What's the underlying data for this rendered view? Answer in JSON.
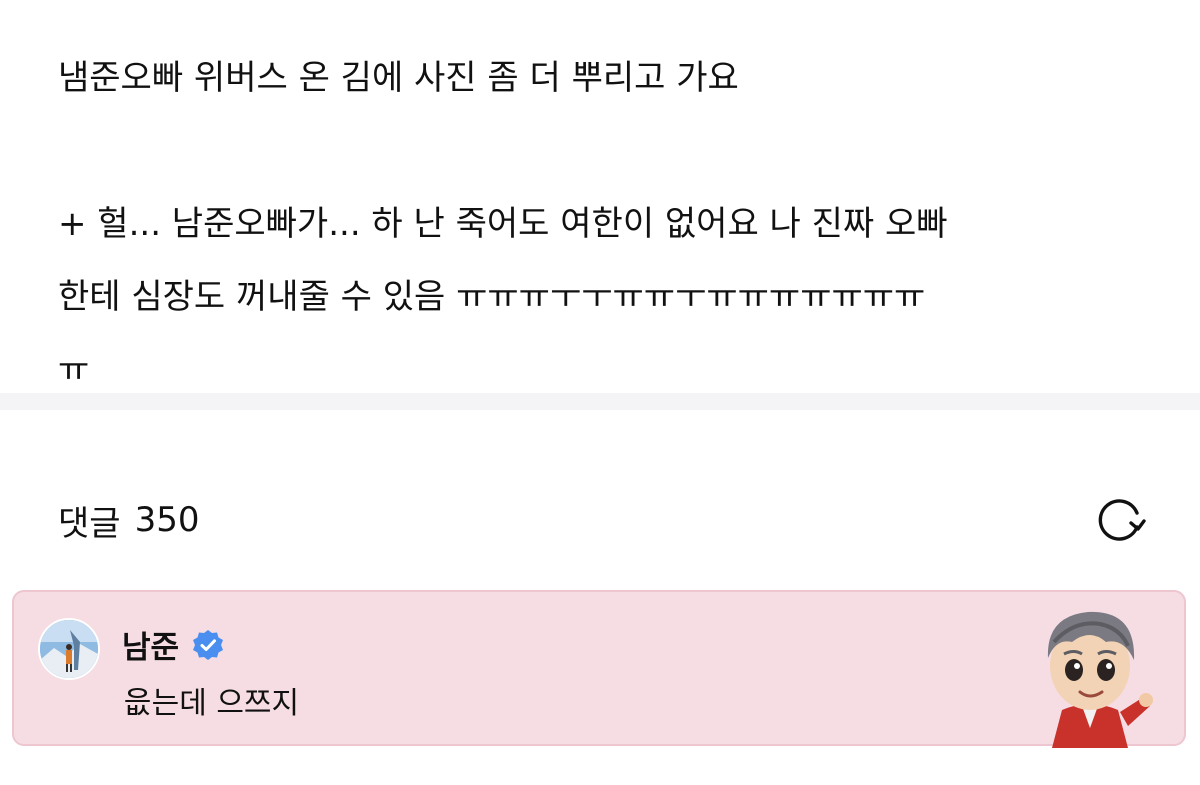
{
  "post": {
    "line1": "냄준오빠 위버스 온 김에 사진 좀 더 뿌리고 가요",
    "line2": "+ 헐... 남준오빠가... 하 난 죽어도 여한이 없어요 나 진짜 오빠",
    "line3": "한테 심장도 꺼내줄 수 있음 ㅠㅠㅠㅜㅜㅠㅠㅜㅠㅠㅠㅠㅠㅠㅠ",
    "line4": "ㅠ"
  },
  "comments": {
    "label": "댓글",
    "count": "350",
    "refresh_icon": "refresh-icon",
    "items": [
      {
        "author": "남준",
        "verified_icon": "verified-badge-icon",
        "text": "읎는데 으쯔지",
        "background_color": "#f5dde3",
        "border_color": "#edc6d0"
      }
    ]
  },
  "colors": {
    "verified_badge": "#4a8ef0",
    "divider": "#f4f4f7",
    "text": "#111111"
  }
}
